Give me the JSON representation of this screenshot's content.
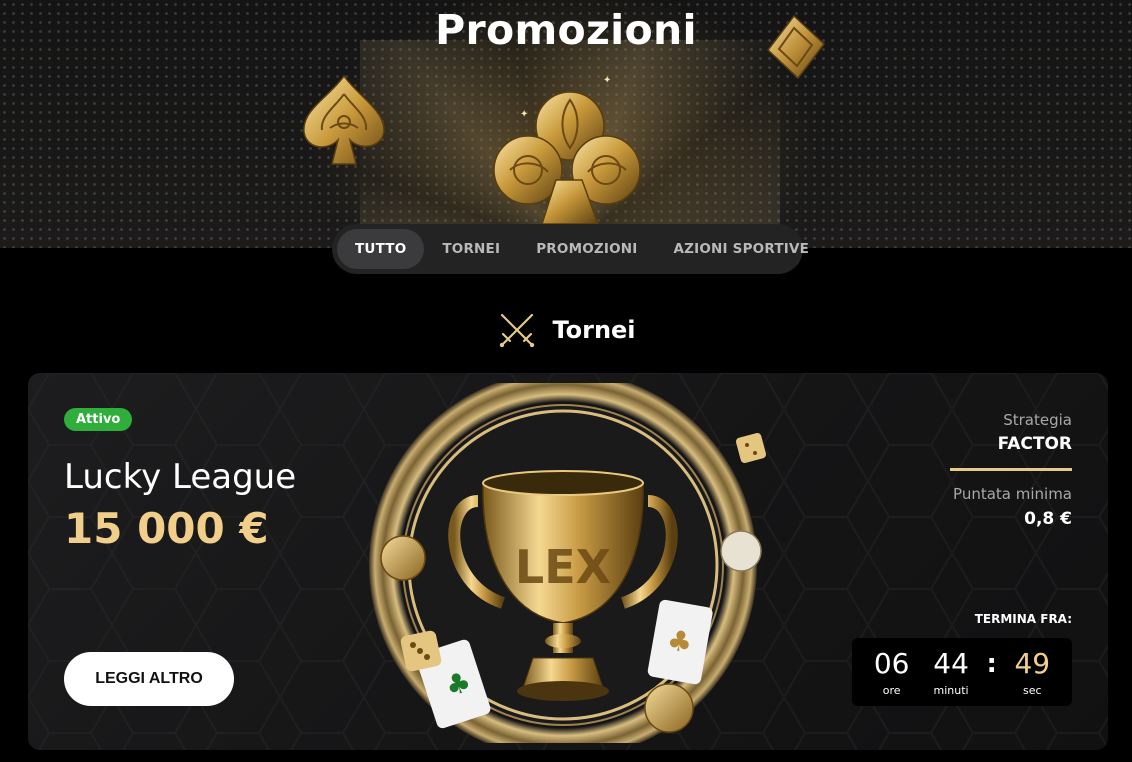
{
  "hero": {
    "title": "Promozioni"
  },
  "tabs": [
    {
      "label": "TUTTO",
      "active": true
    },
    {
      "label": "TORNEI",
      "active": false
    },
    {
      "label": "PROMOZIONI",
      "active": false
    },
    {
      "label": "AZIONI SPORTIVE",
      "active": false
    }
  ],
  "section": {
    "title": "Tornei",
    "icon": "crossed-swords-icon"
  },
  "tournament": {
    "status": "Attivo",
    "name": "Lucky League",
    "prize": "15 000 €",
    "more_label": "LEGGI ALTRO",
    "strategy_label": "Strategia",
    "strategy_value": "FACTOR",
    "min_bet_label": "Puntata minima",
    "min_bet_value": "0,8 €",
    "ends_label": "TERMINA FRA:",
    "trophy_text": "LEX",
    "timer": {
      "hours": "06",
      "hours_label": "ore",
      "minutes": "44",
      "minutes_label": "minuti",
      "separator": ":",
      "seconds": "49",
      "seconds_label": "sec"
    }
  },
  "colors": {
    "gold": "#f1cf8a",
    "badge_green": "#2fae3c",
    "tab_bar": "#232324",
    "tab_active": "#3b3b3d"
  }
}
